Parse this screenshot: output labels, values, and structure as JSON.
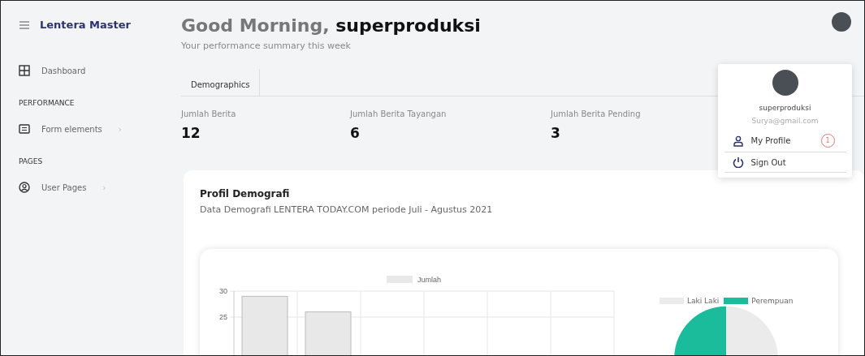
{
  "sidebar": {
    "brand": "Lentera Master",
    "items": [
      {
        "kind": "link",
        "label": "Dashboard"
      },
      {
        "kind": "heading",
        "label": "PERFORMANCE"
      },
      {
        "kind": "link",
        "label": "Form elements",
        "arrow": "›"
      },
      {
        "kind": "heading",
        "label": "PAGES"
      },
      {
        "kind": "link",
        "label": "User Pages",
        "arrow": "›"
      }
    ]
  },
  "header": {
    "greeting": "Good Morning, **superproduksi**",
    "subtitle": "Your performance summary this week"
  },
  "tabs": [
    {
      "label": "Demographics",
      "selected": true
    }
  ],
  "stats": [
    {
      "label": "Jumlah Berita",
      "value": "12"
    },
    {
      "label": "Jumlah Berita Tayangan",
      "value": "6"
    },
    {
      "label": "Jumlah Berita Pending",
      "value": "3"
    }
  ],
  "user_menu": {
    "name": "superproduksi",
    "email": "Surya@gmail.com",
    "items": [
      {
        "kind": "profile",
        "label": "My Profile",
        "badge": "1"
      },
      {
        "kind": "signout",
        "label": "Sign Out"
      }
    ]
  },
  "card": {
    "title": "Profil Demografi",
    "subtitle": "Data Demografi LENTERA TODAY.COM periode Juli - Agustus 2021",
    "chart_data": {
      "type": "bar",
      "series": [
        {
          "name": "Jumlah",
          "color": "#e8e8e8",
          "values": [
            29,
            26,
            null,
            null,
            null,
            null
          ]
        }
      ],
      "ylim": [
        0,
        30
      ],
      "yticks": [
        25,
        30
      ]
    },
    "pie_legend": [
      {
        "label": "Laki Laki",
        "color": "#ebebeb"
      },
      {
        "label": "Perempuan",
        "color": "#1abc9c"
      }
    ]
  }
}
